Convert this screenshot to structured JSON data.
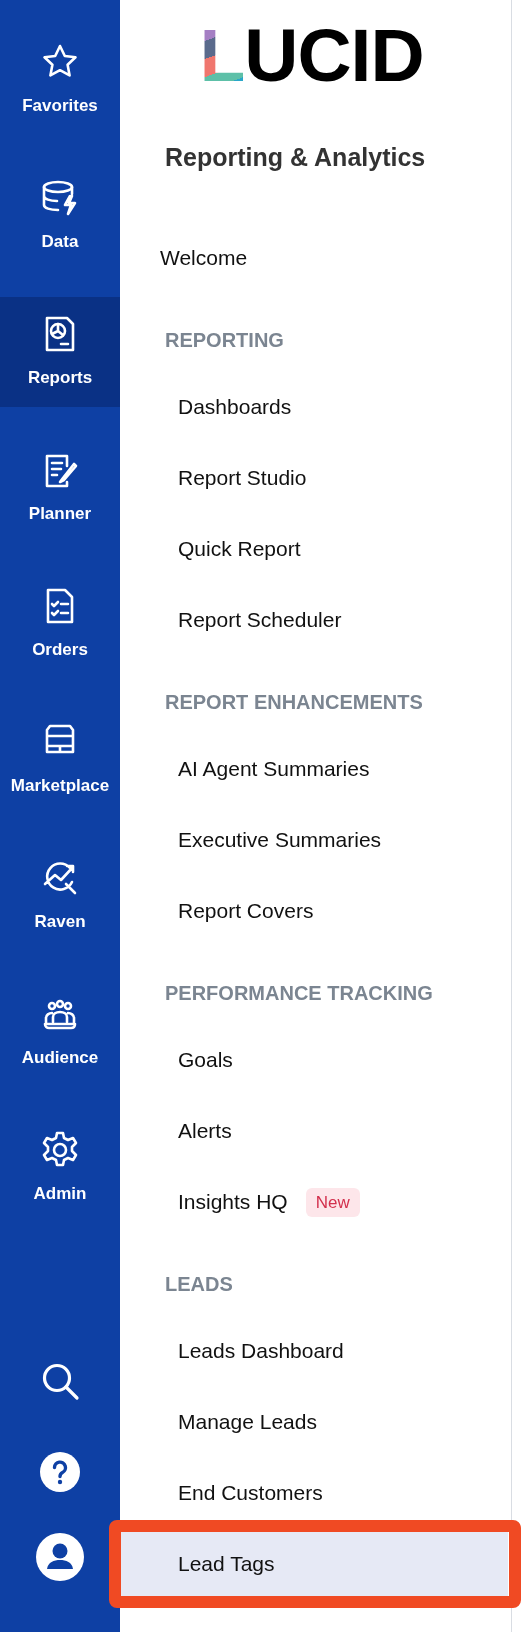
{
  "nav": [
    {
      "label": "Favorites",
      "kind": "star",
      "selected": false
    },
    {
      "label": "Data",
      "kind": "database",
      "selected": false
    },
    {
      "label": "Reports",
      "kind": "report",
      "selected": true
    },
    {
      "label": "Planner",
      "kind": "planner",
      "selected": false
    },
    {
      "label": "Orders",
      "kind": "orders",
      "selected": false
    },
    {
      "label": "Marketplace",
      "kind": "store",
      "selected": false
    },
    {
      "label": "Raven",
      "kind": "raven",
      "selected": false
    },
    {
      "label": "Audience",
      "kind": "audience",
      "selected": false
    },
    {
      "label": "Admin",
      "kind": "gear",
      "selected": false
    }
  ],
  "logo": "LUCID",
  "panel": {
    "title": "Reporting & Analytics",
    "entries": [
      {
        "kind": "link",
        "label": "Welcome",
        "selected": false
      },
      {
        "kind": "heading",
        "label": "REPORTING"
      },
      {
        "kind": "item",
        "label": "Dashboards",
        "selected": false
      },
      {
        "kind": "item",
        "label": "Report Studio",
        "selected": false
      },
      {
        "kind": "item",
        "label": "Quick Report",
        "selected": false
      },
      {
        "kind": "item",
        "label": "Report Scheduler",
        "selected": false
      },
      {
        "kind": "heading",
        "label": "REPORT ENHANCEMENTS"
      },
      {
        "kind": "item",
        "label": "AI Agent Summaries",
        "selected": false
      },
      {
        "kind": "item",
        "label": "Executive Summaries",
        "selected": false
      },
      {
        "kind": "item",
        "label": "Report Covers",
        "selected": false
      },
      {
        "kind": "heading",
        "label": "PERFORMANCE TRACKING"
      },
      {
        "kind": "item",
        "label": "Goals",
        "selected": false
      },
      {
        "kind": "item",
        "label": "Alerts",
        "selected": false
      },
      {
        "kind": "item",
        "label": "Insights HQ",
        "badge": "New",
        "selected": false
      },
      {
        "kind": "heading",
        "label": "LEADS"
      },
      {
        "kind": "item",
        "label": "Leads Dashboard",
        "selected": false
      },
      {
        "kind": "item",
        "label": "Manage Leads",
        "selected": false
      },
      {
        "kind": "item",
        "label": "End Customers",
        "selected": false
      },
      {
        "kind": "item",
        "label": "Lead Tags",
        "selected": true
      }
    ]
  }
}
